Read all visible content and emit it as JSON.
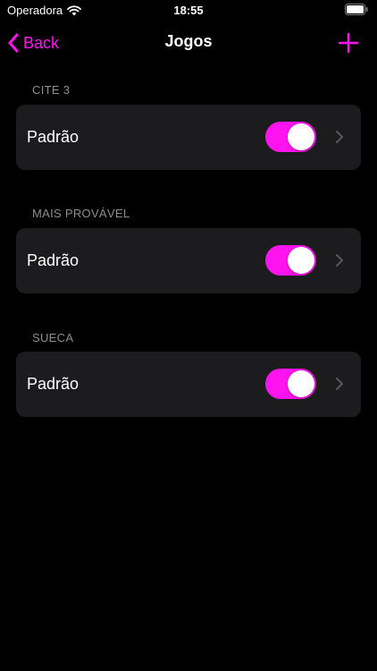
{
  "status_bar": {
    "carrier": "Operadora",
    "time": "18:55",
    "wifi_icon": "wifi-icon",
    "battery_icon": "battery-icon"
  },
  "nav": {
    "back_label": "Back",
    "title": "Jogos",
    "add_icon": "plus-icon"
  },
  "colors": {
    "accent": "#ff14f0",
    "card_background": "#1c1c1e",
    "section_header": "#8e8e93",
    "background": "#000000"
  },
  "sections": [
    {
      "header": "CITE 3",
      "row_label": "Padrão",
      "toggle_on": true
    },
    {
      "header": "MAIS PROVÁVEL",
      "row_label": "Padrão",
      "toggle_on": true
    },
    {
      "header": "SUECA",
      "row_label": "Padrão",
      "toggle_on": true
    }
  ]
}
